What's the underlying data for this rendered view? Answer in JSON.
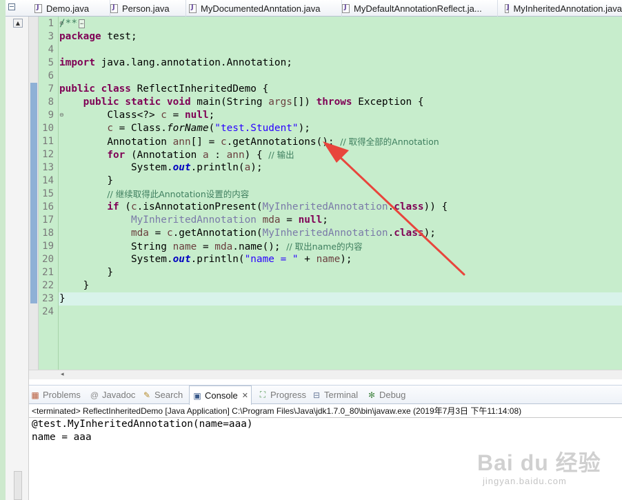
{
  "editor_tabs": [
    {
      "label": "Demo.java"
    },
    {
      "label": "Person.java"
    },
    {
      "label": "MyDocumentedAnntation.java"
    },
    {
      "label": "MyDefaultAnnotationReflect.ja..."
    },
    {
      "label": "MyInheritedAnnotation.java"
    }
  ],
  "code": {
    "line_numbers": [
      "1",
      "3",
      "4",
      "5",
      "6",
      "7",
      "8",
      "9",
      "10",
      "11",
      "12",
      "13",
      "14",
      "15",
      "16",
      "17",
      "18",
      "19",
      "20",
      "21",
      "22",
      "23",
      "24"
    ],
    "l1_comment": "/**",
    "l3_kw": "package",
    "l3_rest": " test;",
    "l5_kw": "import",
    "l5_rest": " java.lang.annotation.Annotation;",
    "l7_kw1": "public",
    "l7_kw2": "class",
    "l7_rest": " ReflectInheritedDemo {",
    "l8_kw1": "public",
    "l8_kw2": "static",
    "l8_kw3": "void",
    "l8_a": " main(String ",
    "l8_var": "args",
    "l8_b": "[]) ",
    "l8_kw4": "throws",
    "l8_c": " Exception {",
    "l9_a": "Class<?> ",
    "l9_var": "c",
    "l9_b": " = ",
    "l9_kw": "null",
    "l9_c": ";",
    "l10_var": "c",
    "l10_a": " = Class.",
    "l10_sm": "forName",
    "l10_b": "(",
    "l10_str": "\"test.Student\"",
    "l10_c": ");",
    "l11_a": "Annotation ",
    "l11_var": "ann",
    "l11_b": "[] = ",
    "l11_var2": "c",
    "l11_c": ".getAnnotations(); ",
    "l11_cm": "// 取得全部的Annotation",
    "l12_kw": "for",
    "l12_a": " (Annotation ",
    "l12_var": "a",
    "l12_b": " : ",
    "l12_var2": "ann",
    "l12_c": ") { ",
    "l12_cm": "// 输出",
    "l13_a": "System.",
    "l13_fld": "out",
    "l13_b": ".println(",
    "l13_var": "a",
    "l13_c": ");",
    "l14": "}",
    "l15_cm": "// 继续取得此Annotation设置的内容",
    "l16_kw": "if",
    "l16_a": " (",
    "l16_var": "c",
    "l16_b": ".isAnnotationPresent(",
    "l16_ty": "MyInheritedAnnotation",
    "l16_c": ".",
    "l16_kw2": "class",
    "l16_d": ")) {",
    "l17_ty": "MyInheritedAnnotation",
    "l17_a": " ",
    "l17_var": "mda",
    "l17_b": " = ",
    "l17_kw": "null",
    "l17_c": ";",
    "l18_var": "mda",
    "l18_a": " = ",
    "l18_var2": "c",
    "l18_b": ".getAnnotation(",
    "l18_ty": "MyInheritedAnnotation",
    "l18_c": ".",
    "l18_kw": "class",
    "l18_d": ");",
    "l19_a": "String ",
    "l19_var": "name",
    "l19_b": " = ",
    "l19_var2": "mda",
    "l19_c": ".name(); ",
    "l19_cm": "// 取出name的内容",
    "l20_a": "System.",
    "l20_fld": "out",
    "l20_b": ".println(",
    "l20_str": "\"name = \"",
    "l20_c": " + ",
    "l20_var": "name",
    "l20_d": ");",
    "l21": "}",
    "l22": "}",
    "l23": "}"
  },
  "view_tabs": [
    {
      "label": "Problems",
      "icon": "problems-icon"
    },
    {
      "label": "Javadoc",
      "icon": "javadoc-icon"
    },
    {
      "label": "Search",
      "icon": "search-icon"
    },
    {
      "label": "Console",
      "icon": "console-icon",
      "active": true
    },
    {
      "label": "Progress",
      "icon": "progress-icon"
    },
    {
      "label": "Terminal",
      "icon": "terminal-icon"
    },
    {
      "label": "Debug",
      "icon": "debug-icon"
    }
  ],
  "console": {
    "status": "<terminated> ReflectInheritedDemo [Java Application] C:\\Program Files\\Java\\jdk1.7.0_80\\bin\\javaw.exe (2019年7月3日 下午11:14:08)",
    "output": [
      "@test.MyInheritedAnnotation(name=aaa)",
      "name = aaa"
    ]
  },
  "watermark": {
    "logo": "Bai du 经验",
    "sub": "jingyan.baidu.com"
  },
  "colors": {
    "editor_bg": "#c7edcc",
    "keyword": "#7f0055",
    "comment": "#3f7f5f",
    "string": "#2a00ff",
    "arrow": "#e8453c"
  }
}
